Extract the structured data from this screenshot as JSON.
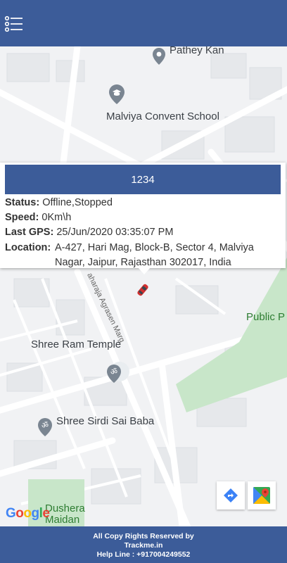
{
  "appbar": {
    "menu_icon": "menu-list-icon",
    "background": "#3c5c99"
  },
  "map": {
    "labels": {
      "pathey_kan": "Pathey Kan",
      "malviya_convent_school": "Malviya Convent School",
      "maharaja_agrasen_marg": "aharaja Agrasen Marg",
      "public_p": "Public P",
      "shree_ram_temple": "Shree Ram Temple",
      "shree_sirdi_sai_baba": "Shree Sirdi Sai Baba",
      "dushera_maidan_1": "Dushera",
      "dushera_maidan_2": "Maidan"
    },
    "google_logo": {
      "G": "G",
      "o1": "o",
      "o2": "o",
      "g": "g",
      "l": "l",
      "e": "e"
    },
    "vehicle_icon": "red-car-icon"
  },
  "infowindow": {
    "vehicle_id": "1234",
    "status_label": "Status:",
    "status_value": "Offline,Stopped",
    "speed_label": "Speed:",
    "speed_value": "0Km\\h",
    "lastgps_label": "Last GPS:",
    "lastgps_value": "25/Jun/2020 03:35:07 PM",
    "location_label": "Location:",
    "location_line1": "A-427, Hari Mag, Block-B, Sector 4, Malviya",
    "location_line2": "Nagar, Jaipur, Rajasthan 302017, India"
  },
  "controls": {
    "directions_icon": "directions-icon",
    "google_maps_icon": "google-maps-icon"
  },
  "footer": {
    "line1": "All Copy Rights Reserved by",
    "line2": "Trackme.in",
    "line3": "Help Line : +917004249552"
  },
  "colors": {
    "brand": "#3c5c99",
    "park": "#c8e6c9",
    "road": "#ffffff"
  }
}
